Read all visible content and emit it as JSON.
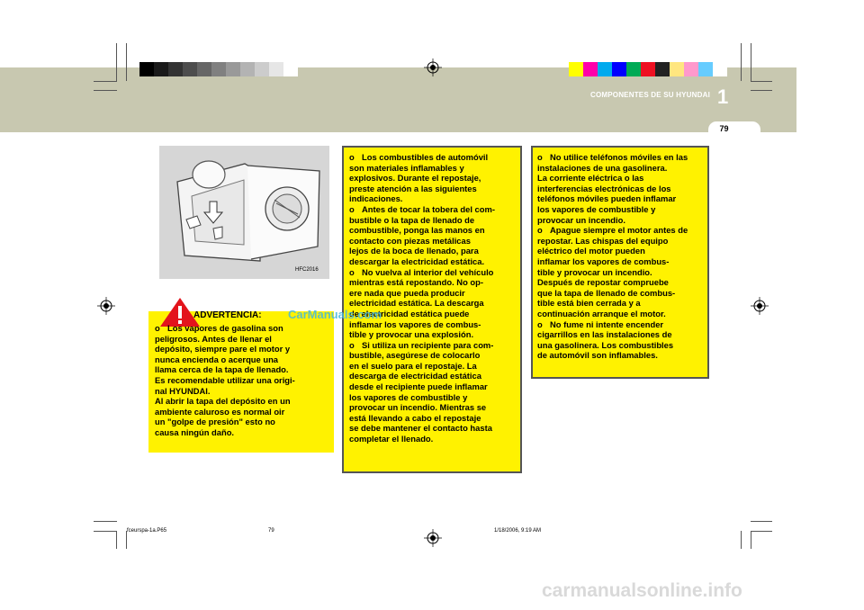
{
  "header": {
    "chapter_title": "COMPONENTES DE SU HYUNDAI",
    "chapter_number": "1",
    "page_number": "79"
  },
  "registration": {
    "gray_swatches": [
      "#000000",
      "#1a1a1a",
      "#333333",
      "#4d4d4d",
      "#666666",
      "#808080",
      "#999999",
      "#b3b3b3",
      "#cccccc",
      "#e6e6e6",
      "#ffffff"
    ],
    "color_swatches": [
      "#ffff00",
      "#ff00aa",
      "#00aaee",
      "#0000ff",
      "#00aa55",
      "#ee1122",
      "#222222",
      "#ffe680",
      "#ff99cc",
      "#66ccff",
      "#ffffff"
    ]
  },
  "figure": {
    "code": "HFC2016"
  },
  "warning": {
    "title": "ADVERTENCIA:",
    "bullet": "o",
    "items": [
      {
        "lines": [
          "Los vapores de gasolina son",
          "peligrosos. Antes de llenar el",
          "depósito, siempre pare el motor y",
          "nunca encienda o acerque una",
          "llama cerca de la tapa de llenado.",
          "Es recomendable utilizar una origi-",
          "nal HYUNDAI.",
          "Al abrir la tapa del depósito en un",
          "ambiente caluroso es normal oir",
          "un \"golpe de presión\" esto no",
          "causa ningún daño."
        ]
      }
    ]
  },
  "middle_box": {
    "items": [
      {
        "lines": [
          "Los combustibles de automóvil",
          "son materiales inflamables y",
          "explosivos. Durante el repostaje,",
          "preste atención a las siguientes",
          "indicaciones."
        ]
      },
      {
        "lines": [
          "Antes de tocar la tobera del com-",
          "bustible o la tapa de llenado de",
          "combustible, ponga las manos en",
          "contacto con piezas metálicas",
          "lejos de la boca de llenado, para",
          "descargar la electricidad estática."
        ]
      },
      {
        "lines": [
          "No vuelva al interior del vehículo",
          "mientras está repostando. No op-",
          "ere nada que pueda producir",
          "electricidad estática. La descarga",
          "de electricidad estática puede",
          "inflamar los vapores de combus-",
          "tible y provocar una explosión."
        ]
      },
      {
        "lines": [
          "Si utiliza un recipiente para com-",
          "bustible, asegúrese de colocarlo",
          "en el suelo para el repostaje. La",
          "descarga de electricidad estática",
          "desde el recipiente puede inflamar",
          "los vapores de combustible y",
          "provocar un incendio. Mientras se",
          "está llevando a cabo el repostaje",
          "se debe mantener el contacto hasta",
          "completar el llenado."
        ]
      }
    ]
  },
  "right_box": {
    "items": [
      {
        "lines": [
          "No utilice teléfonos móviles en las",
          "instalaciones de una gasolinera.",
          "La corriente eléctrica o las",
          "interferencias electrónicas de los",
          "teléfonos móviles pueden inflamar",
          "los vapores de combustible y",
          "provocar un incendio."
        ]
      },
      {
        "lines": [
          "Apague siempre el motor antes de",
          "repostar. Las chispas del equipo",
          "eléctrico del motor pueden",
          "inflamar los vapores de combus-",
          "tible y provocar un incendio.",
          "Después de repostar compruebe",
          "que la tapa de llenado de combus-",
          "tible está bien cerrada y a",
          "continuación arranque el motor."
        ]
      },
      {
        "lines": [
          "No fume ni intente encender",
          "cigarrillos en las instalaciones de",
          "una gasolinera. Los combustibles",
          "de automóvil son inflamables."
        ]
      }
    ]
  },
  "watermarks": {
    "mid": "CarManuals.com",
    "bottom": "carmanualsonline.info"
  },
  "footer": {
    "file": "fceurspa-1a.P65",
    "page": "79",
    "datetime": "1/18/2006, 9:19 AM"
  }
}
